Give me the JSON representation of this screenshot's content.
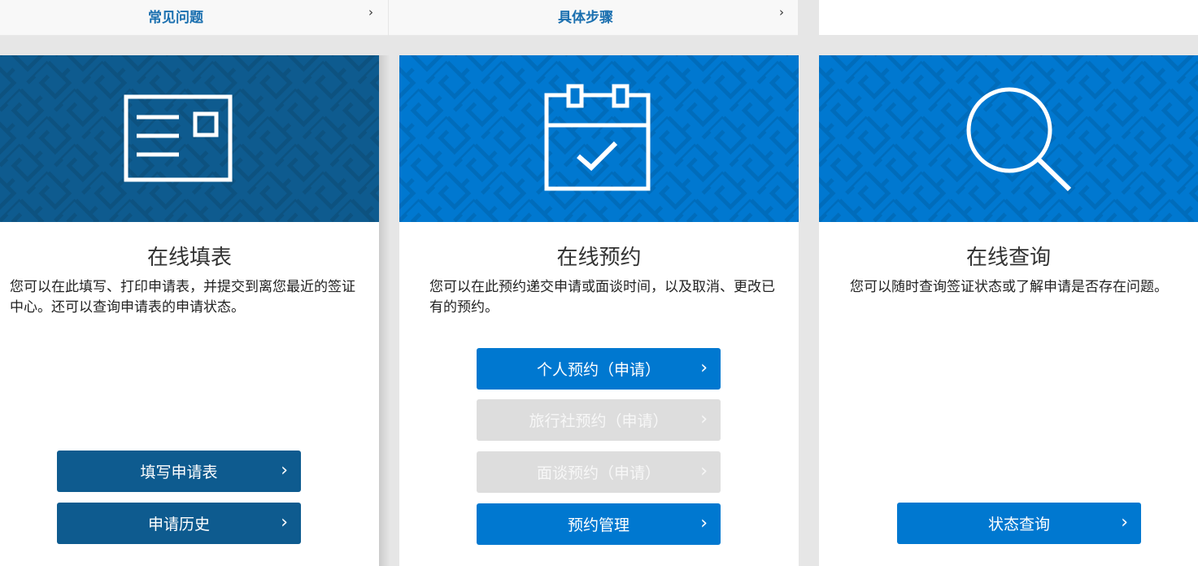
{
  "topnav": {
    "faq_label": "常见问题",
    "steps_label": "具体步骤",
    "chevron": "›"
  },
  "colors": {
    "navy": "#0e5b8f",
    "blue": "#0078d0",
    "disabled": "#dddddd"
  },
  "cards": [
    {
      "icon": "form-icon",
      "title": "在线填表",
      "description": "您可以在此填写、打印申请表，并提交到离您最近的签证中心。还可以查询申请表的申请状态。",
      "buttons": [
        {
          "label": "填写申请表",
          "state": "enabled"
        },
        {
          "label": "申请历史",
          "state": "enabled"
        }
      ]
    },
    {
      "icon": "calendar-check-icon",
      "title": "在线预约",
      "description": "您可以在此预约递交申请或面谈时间，以及取消、更改已有的预约。",
      "buttons": [
        {
          "label": "个人预约（申请）",
          "state": "enabled"
        },
        {
          "label": "旅行社预约（申请）",
          "state": "disabled"
        },
        {
          "label": "面谈预约（申请）",
          "state": "disabled"
        },
        {
          "label": "预约管理",
          "state": "enabled"
        }
      ]
    },
    {
      "icon": "search-icon",
      "title": "在线查询",
      "description": "您可以随时查询签证状态或了解申请是否存在问题。",
      "buttons": [
        {
          "label": "状态查询",
          "state": "enabled"
        }
      ]
    }
  ]
}
